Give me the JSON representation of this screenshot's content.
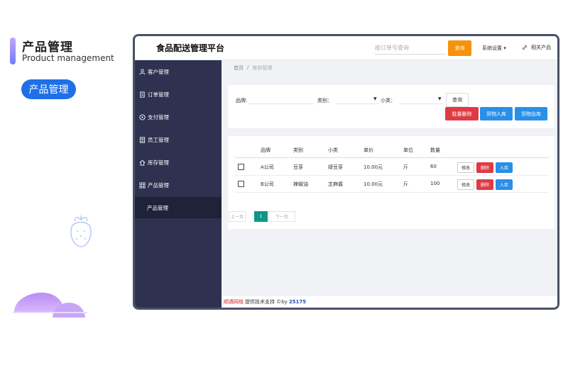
{
  "hero": {
    "title": "产品管理",
    "subtitle": "Product management",
    "pill": "产品管理"
  },
  "app": {
    "title": "食品配送管理平台",
    "search_placeholder": "按订单号查询",
    "search_button": "查询",
    "system_settings": "系统设置",
    "related_products": "相关产品"
  },
  "sidebar": {
    "items": [
      {
        "label": "客户管理",
        "icon": "user-icon"
      },
      {
        "label": "订单管理",
        "icon": "document-icon"
      },
      {
        "label": "支付管理",
        "icon": "compass-icon"
      },
      {
        "label": "员工管理",
        "icon": "badge-icon"
      },
      {
        "label": "库存管理",
        "icon": "home-icon"
      },
      {
        "label": "产品管理",
        "icon": "grid-icon"
      }
    ],
    "sub_item": "产品管理"
  },
  "breadcrumb": {
    "home": "首页",
    "separator": "/",
    "current": "库存管理"
  },
  "filters": {
    "brand_label": "品牌:",
    "category_label": "类别：",
    "subcategory_label": "小类：",
    "query_button": "查询",
    "batch_delete": "批量删除",
    "stock_in": "货物入库",
    "stock_out": "货物出库"
  },
  "table": {
    "headers": [
      "品牌",
      "类别",
      "小类",
      "单价",
      "单位",
      "数量"
    ],
    "rows": [
      {
        "brand": "A公司",
        "category": "豆芽",
        "sub": "绿豆芽",
        "price": "10.00元",
        "unit": "斤",
        "qty": "60"
      },
      {
        "brand": "B公司",
        "category": "辣椒油",
        "sub": "芝麻酱",
        "price": "10.00元",
        "unit": "斤",
        "qty": "100"
      }
    ],
    "actions": {
      "edit": "修改",
      "delete": "删除",
      "in": "入库"
    }
  },
  "pagination": {
    "prev": "上一页",
    "current": "1",
    "next": "下一页"
  },
  "footer": {
    "brand": "顺遇网络",
    "text": "提供技术支持 ©by",
    "number": "25175"
  },
  "colors": {
    "sidebar": "#2e3250",
    "accent_orange": "#f7920b",
    "danger": "#e03a44",
    "primary": "#2a8fe8",
    "pager_active": "#0f9688"
  }
}
